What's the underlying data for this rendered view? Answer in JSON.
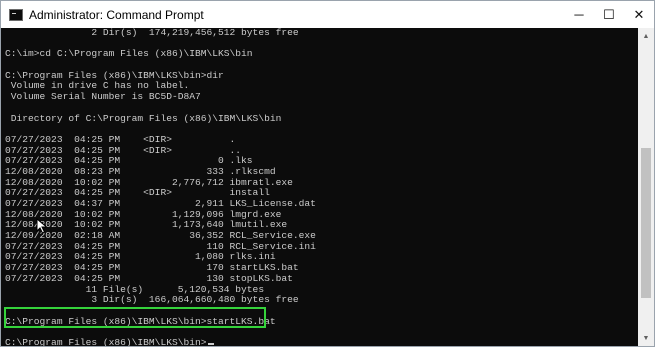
{
  "window": {
    "title": "Administrator: Command Prompt",
    "controls": {
      "minimize": "─",
      "maximize": "☐",
      "close": "✕"
    }
  },
  "console": {
    "lines": [
      "               2 Dir(s)  174,219,456,512 bytes free",
      "",
      "C:\\im>cd C:\\Program Files (x86)\\IBM\\LKS\\bin",
      "",
      "C:\\Program Files (x86)\\IBM\\LKS\\bin>dir",
      " Volume in drive C has no label.",
      " Volume Serial Number is BC5D-D8A7",
      "",
      " Directory of C:\\Program Files (x86)\\IBM\\LKS\\bin",
      "",
      "07/27/2023  04:25 PM    <DIR>          .",
      "07/27/2023  04:25 PM    <DIR>          ..",
      "07/27/2023  04:25 PM                 0 .lks",
      "12/08/2020  08:23 PM               333 .rlkscmd",
      "12/08/2020  10:02 PM         2,776,712 ibmratl.exe",
      "07/27/2023  04:25 PM    <DIR>          install",
      "07/27/2023  04:37 PM             2,911 LKS_License.dat",
      "12/08/2020  10:02 PM         1,129,096 lmgrd.exe",
      "12/08/2020  10:02 PM         1,173,640 lmutil.exe",
      "12/09/2020  02:18 AM            36,352 RCL_Service.exe",
      "07/27/2023  04:25 PM               110 RCL_Service.ini",
      "07/27/2023  04:25 PM             1,080 rlks.ini",
      "07/27/2023  04:25 PM               170 startLKS.bat",
      "07/27/2023  04:25 PM               130 stopLKS.bat",
      "              11 File(s)      5,120,534 bytes",
      "               3 Dir(s)  166,064,660,480 bytes free",
      "",
      "C:\\Program Files (x86)\\IBM\\LKS\\bin>startLKS.bat",
      "",
      "C:\\Program Files (x86)\\IBM\\LKS\\bin>"
    ]
  },
  "colors": {
    "console_bg": "#0c0c0c",
    "console_fg": "#cccccc",
    "highlight": "#35d33b"
  },
  "icons": {
    "app": "command-prompt-icon",
    "pointer": "mouse-pointer-icon"
  }
}
